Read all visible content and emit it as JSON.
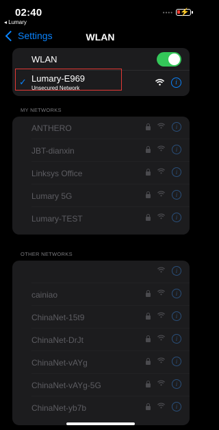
{
  "status": {
    "time": "02:40",
    "back_app": "◂ Lumary",
    "signal": "••••"
  },
  "nav": {
    "back_label": "Settings",
    "title": "WLAN"
  },
  "wlan": {
    "label": "WLAN",
    "enabled": true
  },
  "connected": {
    "name": "Lumary-E969",
    "subtitle": "Unsecured Network"
  },
  "my_networks": {
    "header": "MY NETWORKS",
    "items": [
      "ANTHERO",
      "JBT-dianxin",
      "Linksys Office",
      "Lumary 5G",
      "Lumary-TEST"
    ]
  },
  "other_networks": {
    "header": "OTHER NETWORKS",
    "items": [
      "",
      "cainiao",
      "ChinaNet-15t9",
      "ChinaNet-DrJt",
      "ChinaNet-vAYg",
      "ChinaNet-vAYg-5G",
      "ChinaNet-yb7b"
    ]
  },
  "colors": {
    "accent": "#0a84ff",
    "toggle_on": "#34c759",
    "highlight": "#e53935"
  },
  "icons": {
    "lock": "lock-icon",
    "wifi": "wifi-icon",
    "info": "info-icon",
    "check": "checkmark-icon"
  }
}
